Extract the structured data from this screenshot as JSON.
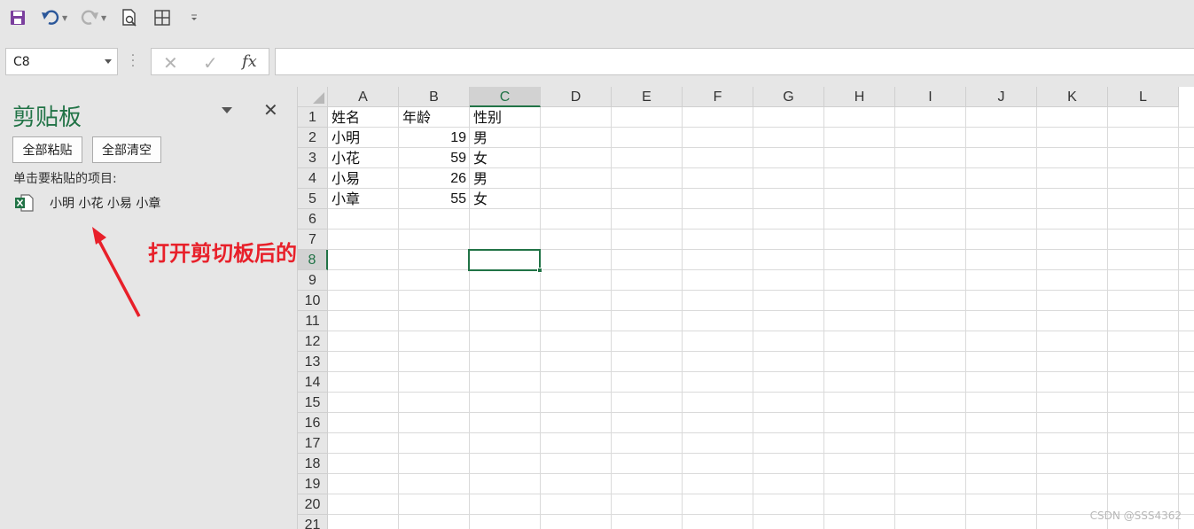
{
  "toolbar": {
    "icons": [
      "save-icon",
      "undo-icon",
      "redo-icon",
      "print-preview-icon",
      "borders-icon",
      "customize-icon"
    ],
    "accent": "#7b3f9e"
  },
  "formula_bar": {
    "name_box": "C8",
    "cancel": "✕",
    "enter": "✓",
    "fx": "fx",
    "value": ""
  },
  "clipboard_pane": {
    "title": "剪贴板",
    "close": "✕",
    "paste_all": "全部粘贴",
    "clear_all": "全部清空",
    "hint": "单击要粘贴的项目:",
    "items": [
      {
        "icon": "excel-icon",
        "text": "小明 小花 小易 小章"
      }
    ]
  },
  "annotation": "打开剪切板后的效果",
  "sheet": {
    "columns": [
      "A",
      "B",
      "C",
      "D",
      "E",
      "F",
      "G",
      "H",
      "I",
      "J",
      "K",
      "L"
    ],
    "rows": [
      "1",
      "2",
      "3",
      "4",
      "5",
      "6",
      "7",
      "8",
      "9",
      "10",
      "11",
      "12",
      "13",
      "14",
      "15",
      "16",
      "17",
      "18",
      "19",
      "20",
      "21"
    ],
    "selected_column": "C",
    "selected_row": "8",
    "data": [
      [
        "姓名",
        "年龄",
        "性别"
      ],
      [
        "小明",
        "19",
        "男"
      ],
      [
        "小花",
        "59",
        "女"
      ],
      [
        "小易",
        "26",
        "男"
      ],
      [
        "小章",
        "55",
        "女"
      ]
    ]
  },
  "watermark": "CSDN @SSS4362",
  "colors": {
    "excel_green": "#217346",
    "annotation_red": "#e8202a"
  }
}
